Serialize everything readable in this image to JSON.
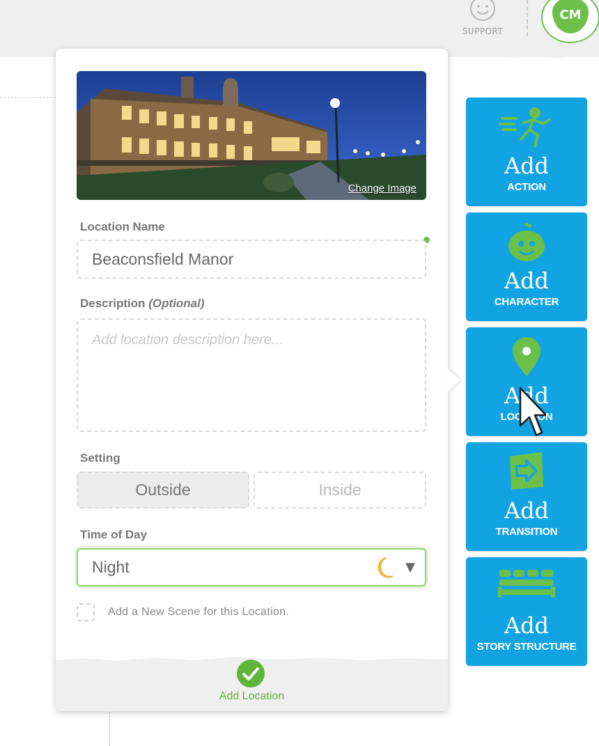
{
  "topbar": {
    "support_label": "SUPPORT",
    "avatar_initials": "CM"
  },
  "form": {
    "change_image_label": "Change Image",
    "location_name_label": "Location Name",
    "location_name_value": "Beaconsfield Manor",
    "description_label": "Description",
    "description_optional": "(Optional)",
    "description_placeholder": "Add location description here...",
    "setting_label": "Setting",
    "setting_options": [
      "Outside",
      "Inside"
    ],
    "setting_selected": "Outside",
    "time_of_day_label": "Time of Day",
    "time_of_day_value": "Night",
    "time_of_day_icon": "moon-icon",
    "new_scene_label": "Add a New Scene for this Location.",
    "new_scene_checked": false,
    "submit_label": "Add Location"
  },
  "sidebar": {
    "buttons": [
      {
        "add": "Add",
        "label": "ACTION",
        "icon": "running-figure-icon"
      },
      {
        "add": "Add",
        "label": "CHARACTER",
        "icon": "character-face-icon"
      },
      {
        "add": "Add",
        "label": "LOCATION",
        "icon": "map-pin-icon"
      },
      {
        "add": "Add",
        "label": "TRANSITION",
        "icon": "arrow-transition-icon"
      },
      {
        "add": "Add",
        "label": "STORY STRUCTURE",
        "icon": "story-structure-icon"
      }
    ]
  },
  "colors": {
    "accent_green": "#6cc04a",
    "button_blue": "#12a3e3"
  }
}
